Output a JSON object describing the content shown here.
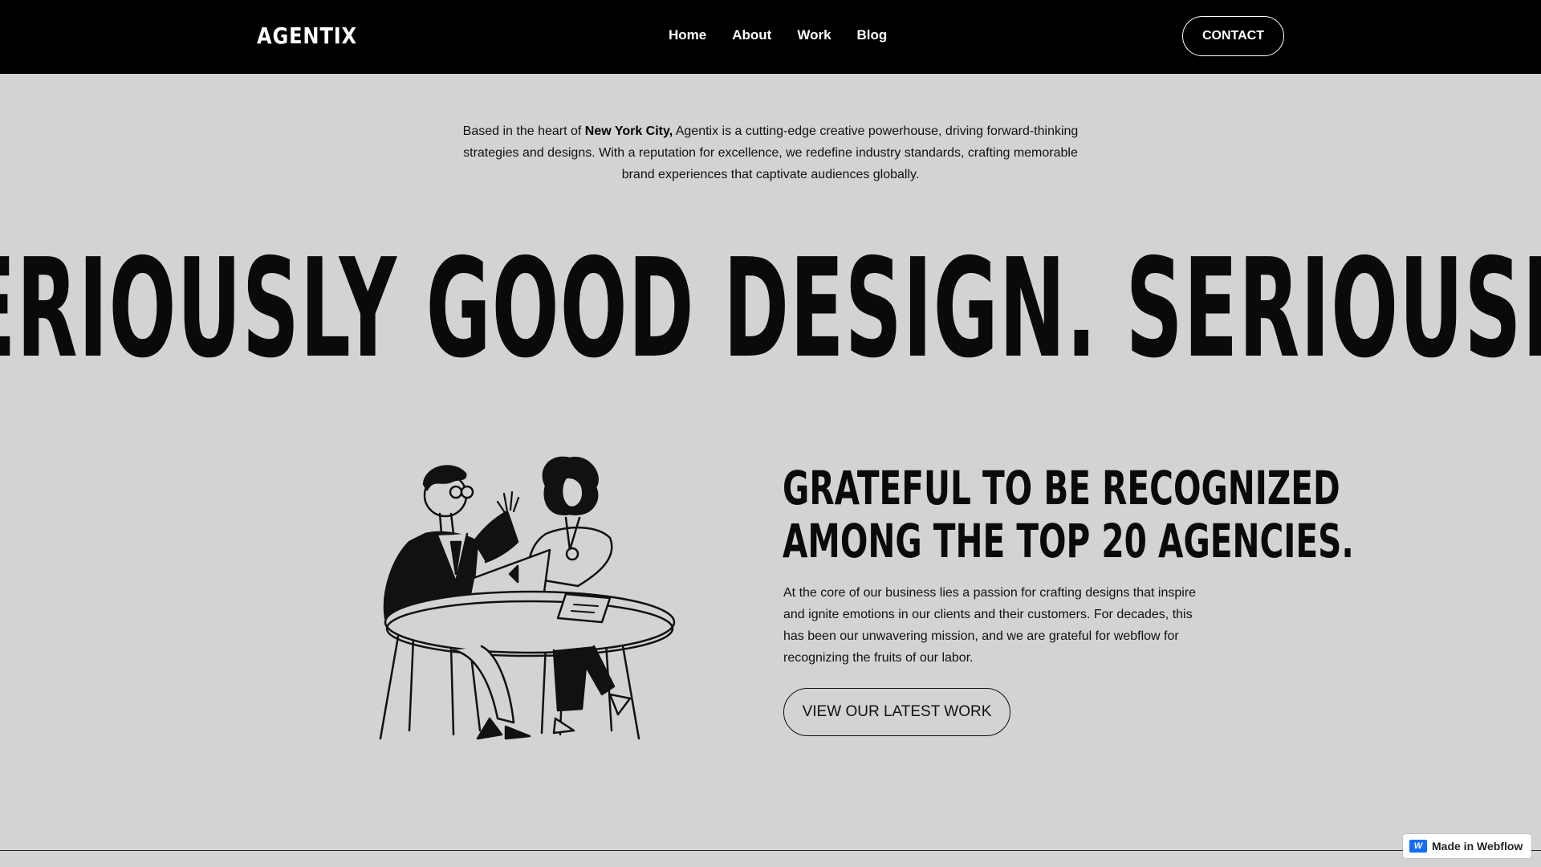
{
  "nav": {
    "logo": "AGENTIX",
    "links": [
      "Home",
      "About",
      "Work",
      "Blog"
    ],
    "contact_label": "CONTACT"
  },
  "intro": {
    "prefix": "Based in the heart of ",
    "highlight": "New York City,",
    "suffix": " Agentix is a cutting-edge creative powerhouse, driving forward-thinking strategies and designs. With a reputation for excellence, we redefine industry standards, crafting memorable brand experiences that captivate audiences globally."
  },
  "marquee": {
    "text": "SERIOUSLY GOOD DESIGN. SERIOUSLY GOOD DESIGN. SERIOUSLY GOOD DESIGN."
  },
  "recognition": {
    "headline_line1": "GRATEFUL TO BE RECOGNIZED",
    "headline_line2": "AMONG THE TOP 20 AGENCIES.",
    "body": "At the core of our business lies a passion for crafting designs that inspire and ignite emotions in our clients and their customers. For decades, this has been our unwavering mission, and we are grateful for webflow for recognizing the fruits of our labor.",
    "button_label": "VIEW OUR LATEST WORK"
  },
  "badge": {
    "label": "Made in Webflow",
    "icon": "webflow-icon",
    "icon_color": "#146ef5"
  },
  "colors": {
    "background": "#d3d3d1",
    "nav_background": "#000000",
    "text": "#0b0b0b"
  }
}
